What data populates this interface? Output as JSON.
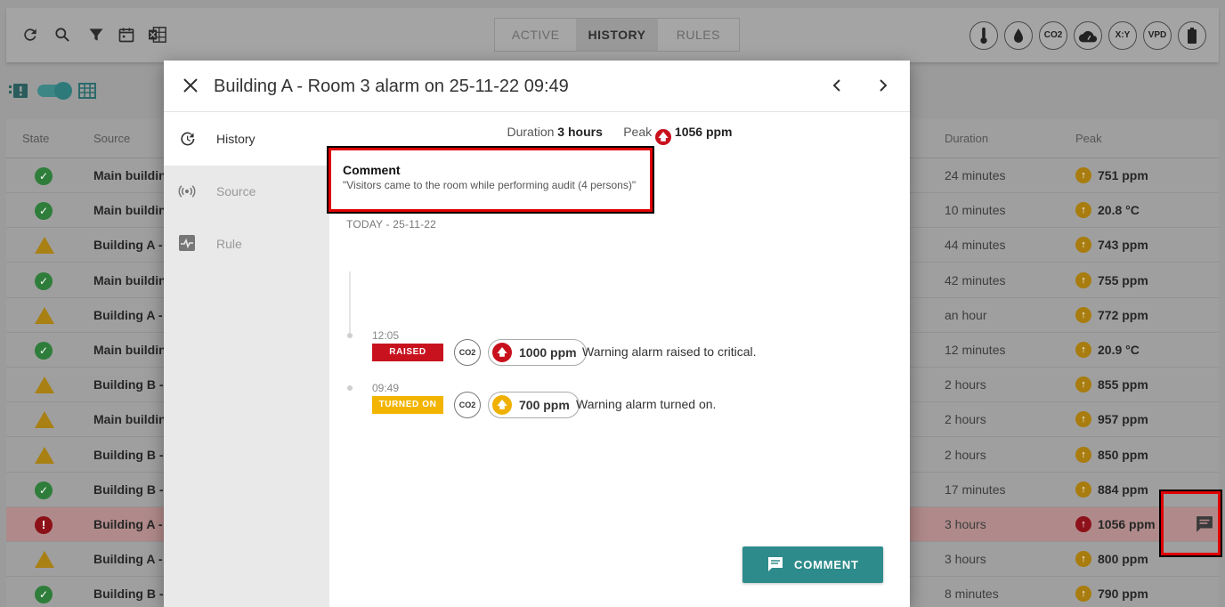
{
  "toolbar": {
    "icons": [
      "refresh-icon",
      "search-icon",
      "filter-icon",
      "calendar-icon",
      "excel-export-icon"
    ],
    "tabs": [
      {
        "label": "ACTIVE",
        "active": false
      },
      {
        "label": "HISTORY",
        "active": true
      },
      {
        "label": "RULES",
        "active": false
      }
    ],
    "sensors": [
      {
        "name": "temperature-icon",
        "label": ""
      },
      {
        "name": "humidity-icon",
        "label": ""
      },
      {
        "name": "co2-icon",
        "label": "CO2"
      },
      {
        "name": "cloud-speed-icon",
        "label": ""
      },
      {
        "name": "xy-icon",
        "label": "X:Y"
      },
      {
        "name": "vpd-icon",
        "label": "VPD"
      },
      {
        "name": "battery-icon",
        "label": ""
      }
    ]
  },
  "table": {
    "headers": {
      "state": "State",
      "source": "Source",
      "duration": "Duration",
      "peak": "Peak"
    },
    "rows": [
      {
        "state": "ok",
        "source": "Main building",
        "duration": "24 minutes",
        "peak": "751 ppm"
      },
      {
        "state": "ok",
        "source": "Main building",
        "duration": "10 minutes",
        "peak": "20.8 °C"
      },
      {
        "state": "warn",
        "source": "Building A - R",
        "duration": "44 minutes",
        "peak": "743 ppm"
      },
      {
        "state": "ok",
        "source": "Main building",
        "duration": "42 minutes",
        "peak": "755 ppm"
      },
      {
        "state": "warn",
        "source": "Building A - R",
        "duration": "an hour",
        "peak": "772 ppm"
      },
      {
        "state": "ok",
        "source": "Main building",
        "duration": "12 minutes",
        "peak": "20.9 °C"
      },
      {
        "state": "warn",
        "source": "Building B - R",
        "duration": "2 hours",
        "peak": "855 ppm"
      },
      {
        "state": "warn",
        "source": "Main building",
        "duration": "2 hours",
        "peak": "957 ppm"
      },
      {
        "state": "warn",
        "source": "Building B - R",
        "duration": "2 hours",
        "peak": "850 ppm"
      },
      {
        "state": "ok",
        "source": "Building B - R",
        "duration": "17 minutes",
        "peak": "884 ppm"
      },
      {
        "state": "crit",
        "source": "Building A - R",
        "duration": "3 hours",
        "peak": "1056 ppm"
      },
      {
        "state": "warn",
        "source": "Building A - R",
        "duration": "3 hours",
        "peak": "800 ppm"
      },
      {
        "state": "ok",
        "source": "Building B - R",
        "duration": "8 minutes",
        "peak": "790 ppm"
      }
    ]
  },
  "modal": {
    "title": "Building A - Room 3 alarm on 25-11-22 09:49",
    "sidebar": [
      {
        "label": "History",
        "icon": "history-icon",
        "active": true
      },
      {
        "label": "Source",
        "icon": "source-icon",
        "active": false
      },
      {
        "label": "Rule",
        "icon": "rule-icon",
        "active": false
      }
    ],
    "summary": {
      "duration_label": "Duration",
      "duration_value": "3 hours",
      "peak_label": "Peak",
      "peak_value": "1056 ppm"
    },
    "comment": {
      "title": "Comment",
      "text": "\"Visitors came to the room while performing audit (4 persons)\""
    },
    "day_label": "TODAY - 25-11-22",
    "events": [
      {
        "time": "12:05",
        "badge": "RAISED",
        "sensor": "CO2",
        "value": "1000 ppm",
        "text": "Warning alarm raised to critical."
      },
      {
        "time": "09:49",
        "badge": "TURNED ON",
        "sensor": "CO2",
        "value": "700 ppm",
        "text": "Warning alarm turned on."
      }
    ],
    "comment_button": "COMMENT"
  },
  "colors": {
    "accent": "#2e8b8b",
    "critical": "#c8131f",
    "warning": "#f3b400",
    "ok": "#2e7d3a",
    "highlight_box": "#e00000"
  }
}
